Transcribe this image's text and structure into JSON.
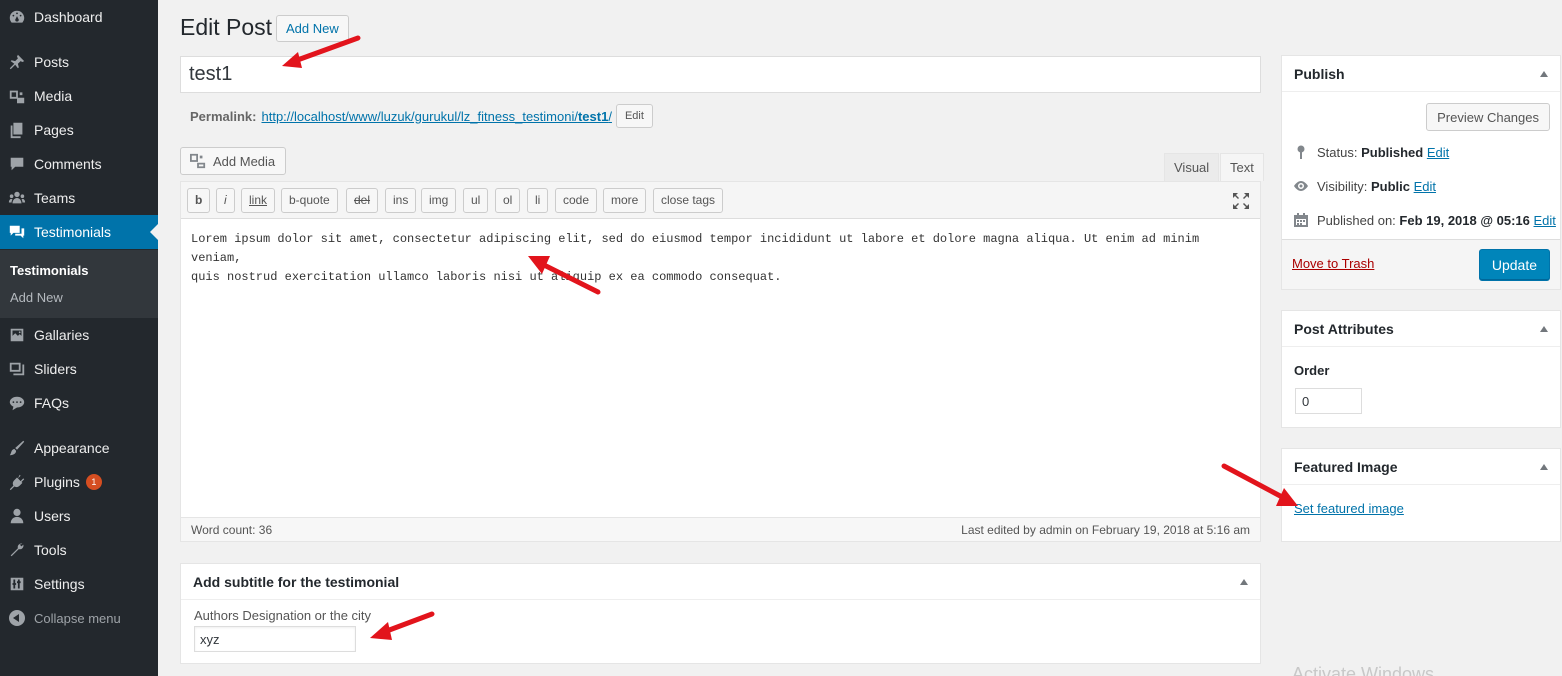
{
  "sidebar": {
    "items": [
      {
        "label": "Dashboard",
        "icon": "dashboard-icon"
      },
      {
        "label": "Posts",
        "icon": "pin-icon"
      },
      {
        "label": "Media",
        "icon": "media-icon"
      },
      {
        "label": "Pages",
        "icon": "pages-icon"
      },
      {
        "label": "Comments",
        "icon": "comments-icon"
      },
      {
        "label": "Teams",
        "icon": "groups-icon"
      },
      {
        "label": "Testimonials",
        "icon": "testimonial-icon"
      },
      {
        "label": "Gallaries",
        "icon": "gallery-icon"
      },
      {
        "label": "Sliders",
        "icon": "slides-icon"
      },
      {
        "label": "FAQs",
        "icon": "faq-icon"
      },
      {
        "label": "Appearance",
        "icon": "brush-icon"
      },
      {
        "label": "Plugins",
        "icon": "plugin-icon",
        "badge": "1"
      },
      {
        "label": "Users",
        "icon": "user-icon"
      },
      {
        "label": "Tools",
        "icon": "wrench-icon"
      },
      {
        "label": "Settings",
        "icon": "settings-icon"
      }
    ],
    "submenu": [
      "Testimonials",
      "Add New"
    ],
    "collapse_label": "Collapse menu"
  },
  "header": {
    "title": "Edit Post",
    "add_new": "Add New"
  },
  "post": {
    "title": "test1",
    "permalink_label": "Permalink:",
    "permalink_base": "http://localhost/www/luzuk/gurukul/lz_fitness_testimoni/",
    "permalink_slug": "test1",
    "permalink_tail": "/",
    "permalink_edit": "Edit"
  },
  "editor": {
    "add_media": "Add Media",
    "tab_visual": "Visual",
    "tab_text": "Text",
    "toolbar": [
      "b",
      "i",
      "link",
      "b-quote",
      "del",
      "ins",
      "img",
      "ul",
      "ol",
      "li",
      "code",
      "more",
      "close tags"
    ],
    "content": "Lorem ipsum dolor sit amet, consectetur adipiscing elit, sed do eiusmod tempor incididunt ut labore et dolore magna aliqua. Ut enim ad minim veniam,\nquis nostrud exercitation ullamco laboris nisi ut aliquip ex ea commodo consequat.",
    "word_count": "Word count: 36",
    "last_edited": "Last edited by admin on February 19, 2018 at 5:16 am"
  },
  "subtitle_box": {
    "title": "Add subtitle for the testimonial",
    "field_label": "Authors Designation or the city",
    "field_value": "xyz"
  },
  "publish": {
    "title": "Publish",
    "preview": "Preview Changes",
    "status_label": "Status:",
    "status_value": "Published",
    "visibility_label": "Visibility:",
    "visibility_value": "Public",
    "published_label": "Published on:",
    "published_value": "Feb 19, 2018 @ 05:16",
    "edit": "Edit",
    "trash": "Move to Trash",
    "update": "Update"
  },
  "attributes": {
    "title": "Post Attributes",
    "order_label": "Order",
    "order_value": "0"
  },
  "featured": {
    "title": "Featured Image",
    "link": "Set featured image"
  },
  "watermark": "Activate Windows",
  "colors": {
    "sidebar_bg": "#23282d",
    "active": "#0073aa",
    "link": "#0073aa",
    "primary_btn": "#0085ba",
    "trash": "#a00",
    "arrow": "#e2141c"
  }
}
